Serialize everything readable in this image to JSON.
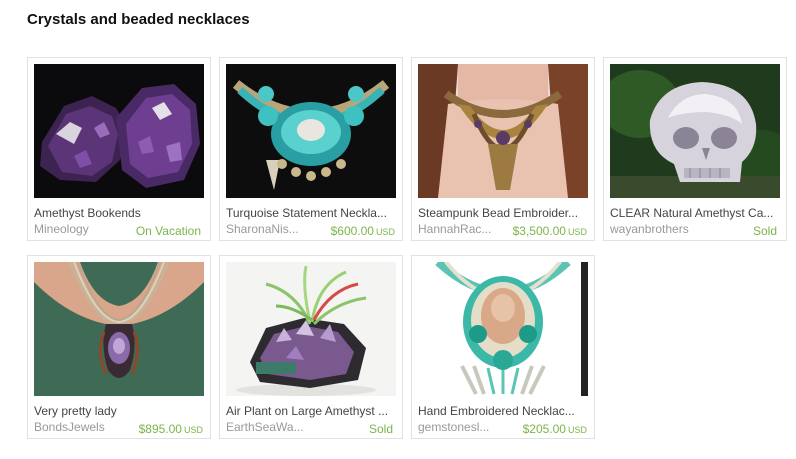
{
  "section": {
    "title": "Crystals and beaded necklaces"
  },
  "items": [
    {
      "title": "Amethyst Bookends",
      "shop": "Mineology",
      "status": "On Vacation",
      "currency": "",
      "image_icon": "amethyst-geode-icon"
    },
    {
      "title": "Turquoise Statement Neckla...",
      "shop": "SharonaNis...",
      "status": "$600.00",
      "currency": "USD",
      "image_icon": "turquoise-necklace-icon"
    },
    {
      "title": "Steampunk Bead Embroider...",
      "shop": "HannahRac...",
      "status": "$3,500.00",
      "currency": "USD",
      "image_icon": "steampunk-necklace-icon"
    },
    {
      "title": "CLEAR Natural Amethyst Ca...",
      "shop": "wayanbrothers",
      "status": "Sold",
      "currency": "",
      "image_icon": "crystal-skull-icon"
    },
    {
      "title": "Very pretty lady",
      "shop": "BondsJewels",
      "status": "$895.00",
      "currency": "USD",
      "image_icon": "pendant-icon"
    },
    {
      "title": "Air Plant on Large Amethyst ...",
      "shop": "EarthSeaWa...",
      "status": "Sold",
      "currency": "",
      "image_icon": "air-plant-icon"
    },
    {
      "title": "Hand Embroidered Necklac...",
      "shop": "gemstonesl...",
      "status": "$205.00",
      "currency": "USD",
      "image_icon": "embroidered-necklace-icon"
    }
  ]
}
